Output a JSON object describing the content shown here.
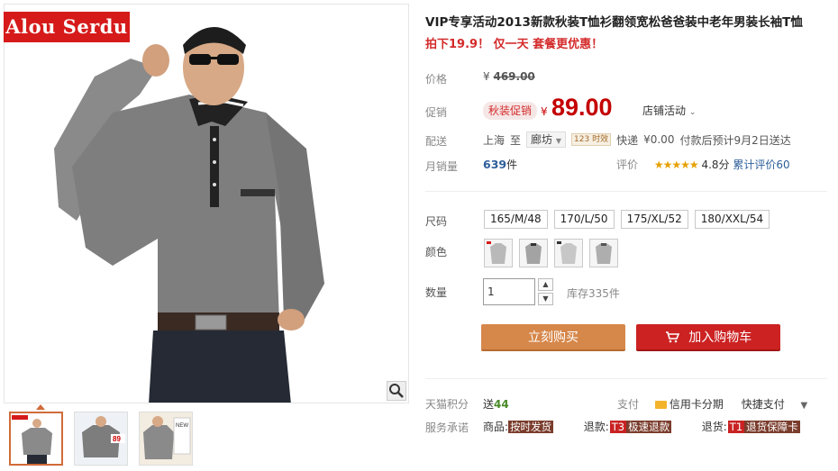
{
  "brand_label": "Alou Serdu",
  "thumbnails": [
    {
      "name": "thumb-1",
      "active": true
    },
    {
      "name": "thumb-2",
      "active": false,
      "badge": "89"
    },
    {
      "name": "thumb-3",
      "active": false,
      "badge": "NEW"
    }
  ],
  "product": {
    "title": "VIP专享活动2013新款秋装T恤衫翻领宽松爸爸装中老年男装长袖T恤",
    "subtitle": "拍下19.9！ 仅一天 套餐更优惠！"
  },
  "price": {
    "label": "价格",
    "currency": "¥",
    "original": "469.00"
  },
  "promo": {
    "label": "促销",
    "badge": "秋装促销",
    "currency": "¥",
    "price": "89.00",
    "store_activity": "店铺活动"
  },
  "shipping": {
    "label": "配送",
    "from": "上海",
    "to_word": "至",
    "dest": "廊坊",
    "tag": "123 时效",
    "method": "快递",
    "fee": "¥0.00",
    "eta": "付款后预计9月2日送达"
  },
  "sales": {
    "label": "月销量",
    "count": "639",
    "unit": "件"
  },
  "review": {
    "label": "评价",
    "stars": "★★★★★",
    "score": "4.8分",
    "count_text": "累计评价60"
  },
  "sizes": {
    "label": "尺码",
    "options": [
      "165/M/48",
      "170/L/50",
      "175/XL/52",
      "180/XXL/54"
    ]
  },
  "colors": {
    "label": "颜色",
    "swatches": [
      "#c9c9c9",
      "#b3b3b3",
      "#d8d8d8",
      "#bdbdbd"
    ]
  },
  "quantity": {
    "label": "数量",
    "value": "1",
    "stock": "库存335件"
  },
  "buttons": {
    "buy": "立刻购买",
    "cart": "加入购物车",
    "cart_icon": "cart-icon"
  },
  "points": {
    "label": "天猫积分",
    "text_prefix": "送",
    "value": "44"
  },
  "payment": {
    "label": "支付",
    "card": "信用卡分期",
    "quick": "快捷支付"
  },
  "service": {
    "label": "服务承诺",
    "item1_label": "商品:",
    "item1_chip": "按时发货",
    "item2_label": "退款:",
    "item2_num": "T3",
    "item2_chip": "极速退款",
    "item3_label": "退货:",
    "item3_num": "T1",
    "item3_chip": "退货保障卡"
  }
}
